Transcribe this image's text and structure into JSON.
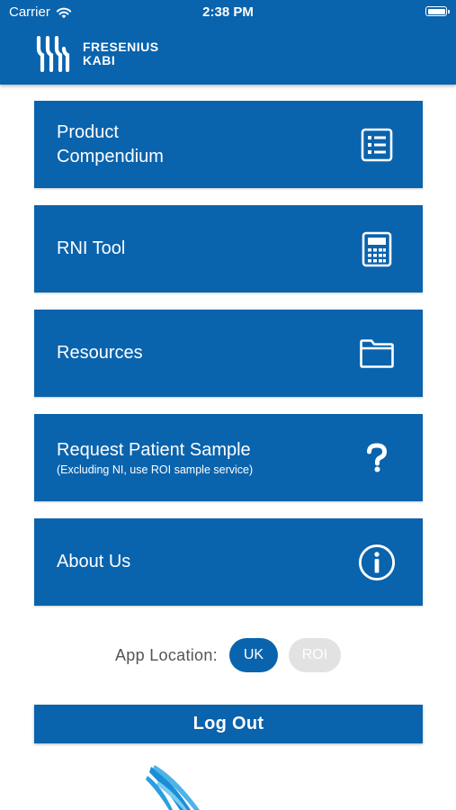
{
  "status_bar": {
    "carrier": "Carrier",
    "time": "2:38 PM"
  },
  "header": {
    "brand_line1": "FRESENIUS",
    "brand_line2": "KABI"
  },
  "menu": {
    "items": [
      {
        "label": "Product\nCompendium",
        "subtitle": "",
        "icon": "document-list-icon"
      },
      {
        "label": "RNI Tool",
        "subtitle": "",
        "icon": "calculator-icon"
      },
      {
        "label": "Resources",
        "subtitle": "",
        "icon": "folder-icon"
      },
      {
        "label": "Request Patient Sample",
        "subtitle": "(Excluding NI, use ROI sample service)",
        "icon": "question-mark-icon"
      },
      {
        "label": "About Us",
        "subtitle": "",
        "icon": "info-icon"
      }
    ]
  },
  "location": {
    "label": "App Location:",
    "options": [
      "UK",
      "ROI"
    ],
    "selected": "UK"
  },
  "logout": {
    "label": "Log Out"
  },
  "colors": {
    "brand_blue": "#0a63ad",
    "inactive_pill": "#e2e2e2",
    "location_label": "#555555"
  }
}
